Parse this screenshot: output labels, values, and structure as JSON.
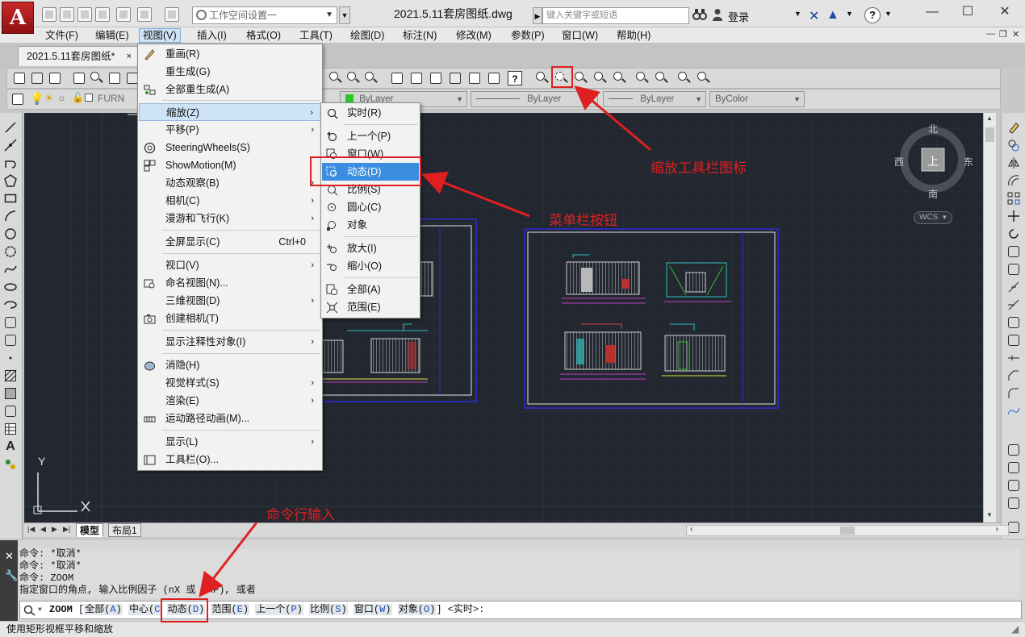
{
  "titlebar": {
    "workspace": "工作空间设置一",
    "document_title": "2021.5.11套房图纸.dwg",
    "search_placeholder": "键入关键字或短语",
    "login": "登录"
  },
  "menubar": {
    "items": [
      "文件(F)",
      "编辑(E)",
      "视图(V)",
      "插入(I)",
      "格式(O)",
      "工具(T)",
      "绘图(D)",
      "标注(N)",
      "修改(M)",
      "参数(P)",
      "窗口(W)",
      "帮助(H)"
    ],
    "active_index": 2
  },
  "doc_tab": {
    "label": "2021.5.11套房图纸*",
    "close": "×"
  },
  "layer_toolbar": {
    "layer_name": "FURN",
    "color": "ByLayer",
    "linetype": "ByLayer",
    "lineweight": "ByLayer",
    "plotstyle": "ByColor"
  },
  "view_menu": {
    "items": [
      {
        "label": "重画(R)",
        "icon": "pencil-icon"
      },
      {
        "label": "重生成(G)",
        "icon": ""
      },
      {
        "label": "全部重生成(A)",
        "icon": "regen-all-icon"
      },
      {
        "label": "缩放(Z)",
        "submenu": true,
        "highlighted": true
      },
      {
        "label": "平移(P)",
        "submenu": true
      },
      {
        "label": "SteeringWheels(S)",
        "icon": "steering-wheel-icon"
      },
      {
        "label": "ShowMotion(M)",
        "icon": "showmotion-icon"
      },
      {
        "label": "动态观察(B)",
        "submenu": true
      },
      {
        "label": "相机(C)",
        "submenu": true
      },
      {
        "label": "漫游和飞行(K)",
        "submenu": true
      },
      {
        "label": "全屏显示(C)",
        "shortcut": "Ctrl+0"
      },
      {
        "label": "视口(V)",
        "submenu": true
      },
      {
        "label": "命名视图(N)...",
        "icon": "named-view-icon"
      },
      {
        "label": "三维视图(D)",
        "submenu": true
      },
      {
        "label": "创建相机(T)",
        "icon": "camera-icon"
      },
      {
        "label": "显示注释性对象(I)",
        "submenu": true
      },
      {
        "label": "消隐(H)",
        "icon": "hide-icon"
      },
      {
        "label": "视觉样式(S)",
        "submenu": true
      },
      {
        "label": "渲染(E)",
        "submenu": true
      },
      {
        "label": "运动路径动画(M)...",
        "icon": "motion-path-icon"
      },
      {
        "label": "显示(L)",
        "submenu": true
      },
      {
        "label": "工具栏(O)...",
        "icon": "toolbar-icon"
      }
    ]
  },
  "zoom_menu": {
    "items": [
      {
        "label": "实时(R)"
      },
      {
        "label": "上一个(P)"
      },
      {
        "label": "窗口(W)"
      },
      {
        "label": "动态(D)",
        "highlighted": true
      },
      {
        "label": "比例(S)"
      },
      {
        "label": "圆心(C)"
      },
      {
        "label": "对象"
      },
      {
        "label": "放大(I)"
      },
      {
        "label": "缩小(O)"
      },
      {
        "label": "全部(A)"
      },
      {
        "label": "范围(E)"
      }
    ]
  },
  "viewcube": {
    "north": "北",
    "south": "南",
    "east": "东",
    "west": "西",
    "face": "上",
    "wcs": "WCS"
  },
  "ucs": {
    "y": "Y"
  },
  "layout_tabs": [
    "模型",
    "布局1"
  ],
  "command_history": [
    "命令: *取消*",
    "命令: *取消*",
    "命令: ZOOM",
    "指定窗口的角点, 输入比例因子 (nX 或 nXP), 或者"
  ],
  "command_line": {
    "command": "ZOOM",
    "bracket_open": "[",
    "options": [
      {
        "text": "全部(",
        "key": "A",
        "close": ")"
      },
      {
        "text": "中心(",
        "key": "C",
        "close": ""
      },
      {
        "text": "动态(",
        "key": "D",
        "close": ")"
      },
      {
        "text": "范围(",
        "key": "E",
        "close": ")"
      },
      {
        "text": "上一个(",
        "key": "P",
        "close": ")"
      },
      {
        "text": "比例(",
        "key": "S",
        "close": ")"
      },
      {
        "text": "窗口(",
        "key": "W",
        "close": ")"
      },
      {
        "text": "对象(",
        "key": "O",
        "close": ")"
      }
    ],
    "suffix": "] <实时>:"
  },
  "status_bar": "使用矩形视框平移和缩放",
  "annotations": {
    "zoom_toolbar": "缩放工具栏图标",
    "menu_button": "菜单栏按钮",
    "command_input": "命令行输入"
  },
  "colors": {
    "annotation": "#e02020",
    "canvas": "#222730",
    "highlight": "#3b8de0"
  }
}
